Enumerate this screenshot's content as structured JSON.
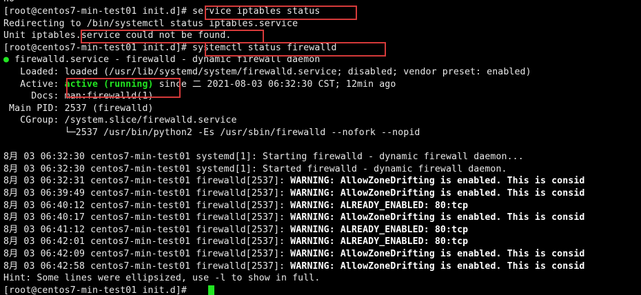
{
  "terminal": {
    "lines": [
      {
        "text": "no"
      },
      {
        "prompt": "[root@centos7-min-test01 init.d]# ",
        "command": "service iptables status"
      },
      {
        "text": "Redirecting to /bin/systemctl status iptables.service"
      },
      {
        "text": "Unit iptables.service could not be found."
      },
      {
        "prompt": "[root@centos7-min-test01 init.d]# ",
        "command": "systemctl status firewalld"
      },
      {
        "bullet": "●",
        "text": " firewalld.service - firewalld - dynamic firewall daemon"
      },
      {
        "text": "   Loaded: loaded (/usr/lib/systemd/system/firewalld.service; disabled; vendor preset: enabled)"
      },
      {
        "label": "   Active: ",
        "status": "active (running)",
        "rest": " since 二 2021-08-03 06:32:30 CST; 12min ago"
      },
      {
        "text": "     Docs: man:firewalld(1)"
      },
      {
        "text": " Main PID: 2537 (firewalld)"
      },
      {
        "text": "   CGroup: /system.slice/firewalld.service"
      },
      {
        "text": "           └─2537 /usr/bin/python2 -Es /usr/sbin/firewalld --nofork --nopid"
      },
      {
        "text": ""
      },
      {
        "text": "8月 03 06:32:30 centos7-min-test01 systemd[1]: Starting firewalld - dynamic firewall daemon..."
      },
      {
        "text": "8月 03 06:32:30 centos7-min-test01 systemd[1]: Started firewalld - dynamic firewall daemon."
      },
      {
        "prefix": "8月 03 06:32:31 centos7-min-test01 firewalld[2537]: ",
        "warning": "WARNING: AllowZoneDrifting is enabled. This is consid"
      },
      {
        "prefix": "8月 03 06:39:49 centos7-min-test01 firewalld[2537]: ",
        "warning": "WARNING: AllowZoneDrifting is enabled. This is consid"
      },
      {
        "prefix": "8月 03 06:40:12 centos7-min-test01 firewalld[2537]: ",
        "warning": "WARNING: ALREADY_ENABLED: 80:tcp"
      },
      {
        "prefix": "8月 03 06:40:17 centos7-min-test01 firewalld[2537]: ",
        "warning": "WARNING: AllowZoneDrifting is enabled. This is consid"
      },
      {
        "prefix": "8月 03 06:41:12 centos7-min-test01 firewalld[2537]: ",
        "warning": "WARNING: ALREADY_ENABLED: 80:tcp"
      },
      {
        "prefix": "8月 03 06:42:01 centos7-min-test01 firewalld[2537]: ",
        "warning": "WARNING: ALREADY_ENABLED: 80:tcp"
      },
      {
        "prefix": "8月 03 06:42:09 centos7-min-test01 firewalld[2537]: ",
        "warning": "WARNING: AllowZoneDrifting is enabled. This is consid"
      },
      {
        "prefix": "8月 03 06:42:58 centos7-min-test01 firewalld[2537]: ",
        "warning": "WARNING: AllowZoneDrifting is enabled. This is consid"
      },
      {
        "text": "Hint: Some lines were ellipsized, use -l to show in full."
      },
      {
        "prompt": "[root@centos7-min-test01 init.d]# ",
        "command": ""
      }
    ]
  },
  "colors": {
    "background": "#000000",
    "text": "#e8e8e8",
    "active_green": "#22e522",
    "highlight_red": "#d53a3a"
  }
}
